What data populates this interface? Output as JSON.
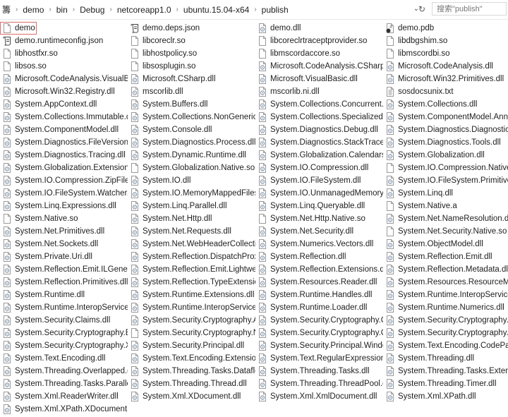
{
  "breadcrumb": [
    "籌",
    "demo",
    "bin",
    "Debug",
    "netcoreapp1.0",
    "ubuntu.15.04-x64",
    "publish"
  ],
  "search": {
    "placeholder": "搜索\"publish\""
  },
  "icons": {
    "dll": "gear-document-icon",
    "blank": "blank-file-icon",
    "json": "script-file-icon",
    "pdb": "pdb-file-icon",
    "txt": "text-file-icon"
  },
  "selected_index": 0,
  "items": [
    {
      "name": "demo",
      "icon": "blank"
    },
    {
      "name": "demo.deps.json",
      "icon": "json"
    },
    {
      "name": "demo.dll",
      "icon": "dll"
    },
    {
      "name": "demo.pdb",
      "icon": "pdb"
    },
    {
      "name": "demo.runtimeconfig.json",
      "icon": "json"
    },
    {
      "name": "libcoreclr.so",
      "icon": "blank"
    },
    {
      "name": "libcoreclrtraceptprovider.so",
      "icon": "blank"
    },
    {
      "name": "libdbgshim.so",
      "icon": "blank"
    },
    {
      "name": "libhostfxr.so",
      "icon": "blank"
    },
    {
      "name": "libhostpolicy.so",
      "icon": "blank"
    },
    {
      "name": "libmscordaccore.so",
      "icon": "blank"
    },
    {
      "name": "libmscordbi.so",
      "icon": "blank"
    },
    {
      "name": "libsos.so",
      "icon": "blank"
    },
    {
      "name": "libsosplugin.so",
      "icon": "blank"
    },
    {
      "name": "Microsoft.CodeAnalysis.CSharp.dll",
      "icon": "dll"
    },
    {
      "name": "Microsoft.CodeAnalysis.dll",
      "icon": "dll"
    },
    {
      "name": "Microsoft.CodeAnalysis.VisualBa...",
      "icon": "dll"
    },
    {
      "name": "Microsoft.CSharp.dll",
      "icon": "dll"
    },
    {
      "name": "Microsoft.VisualBasic.dll",
      "icon": "dll"
    },
    {
      "name": "Microsoft.Win32.Primitives.dll",
      "icon": "dll"
    },
    {
      "name": "Microsoft.Win32.Registry.dll",
      "icon": "dll"
    },
    {
      "name": "mscorlib.dll",
      "icon": "dll"
    },
    {
      "name": "mscorlib.ni.dll",
      "icon": "dll"
    },
    {
      "name": "sosdocsunix.txt",
      "icon": "txt"
    },
    {
      "name": "System.AppContext.dll",
      "icon": "dll"
    },
    {
      "name": "System.Buffers.dll",
      "icon": "dll"
    },
    {
      "name": "System.Collections.Concurrent.dll",
      "icon": "dll"
    },
    {
      "name": "System.Collections.dll",
      "icon": "dll"
    },
    {
      "name": "System.Collections.Immutable.dll",
      "icon": "dll"
    },
    {
      "name": "System.Collections.NonGeneric.dll",
      "icon": "dll"
    },
    {
      "name": "System.Collections.Specialized.dll",
      "icon": "dll"
    },
    {
      "name": "System.ComponentModel.Annot...",
      "icon": "dll"
    },
    {
      "name": "System.ComponentModel.dll",
      "icon": "dll"
    },
    {
      "name": "System.Console.dll",
      "icon": "dll"
    },
    {
      "name": "System.Diagnostics.Debug.dll",
      "icon": "dll"
    },
    {
      "name": "System.Diagnostics.DiagnosticSo...",
      "icon": "dll"
    },
    {
      "name": "System.Diagnostics.FileVersionInf...",
      "icon": "dll"
    },
    {
      "name": "System.Diagnostics.Process.dll",
      "icon": "dll"
    },
    {
      "name": "System.Diagnostics.StackTrace.dll",
      "icon": "dll"
    },
    {
      "name": "System.Diagnostics.Tools.dll",
      "icon": "dll"
    },
    {
      "name": "System.Diagnostics.Tracing.dll",
      "icon": "dll"
    },
    {
      "name": "System.Dynamic.Runtime.dll",
      "icon": "dll"
    },
    {
      "name": "System.Globalization.Calendars.dll",
      "icon": "dll"
    },
    {
      "name": "System.Globalization.dll",
      "icon": "dll"
    },
    {
      "name": "System.Globalization.Extensions.dll",
      "icon": "dll"
    },
    {
      "name": "System.Globalization.Native.so",
      "icon": "blank"
    },
    {
      "name": "System.IO.Compression.dll",
      "icon": "dll"
    },
    {
      "name": "System.IO.Compression.Native.so",
      "icon": "blank"
    },
    {
      "name": "System.IO.Compression.ZipFile.dll",
      "icon": "dll"
    },
    {
      "name": "System.IO.dll",
      "icon": "dll"
    },
    {
      "name": "System.IO.FileSystem.dll",
      "icon": "dll"
    },
    {
      "name": "System.IO.FileSystem.Primitives.dll",
      "icon": "dll"
    },
    {
      "name": "System.IO.FileSystem.Watcher.dll",
      "icon": "dll"
    },
    {
      "name": "System.IO.MemoryMappedFiles.dll",
      "icon": "dll"
    },
    {
      "name": "System.IO.UnmanagedMemorySt...",
      "icon": "dll"
    },
    {
      "name": "System.Linq.dll",
      "icon": "dll"
    },
    {
      "name": "System.Linq.Expressions.dll",
      "icon": "dll"
    },
    {
      "name": "System.Linq.Parallel.dll",
      "icon": "dll"
    },
    {
      "name": "System.Linq.Queryable.dll",
      "icon": "dll"
    },
    {
      "name": "System.Native.a",
      "icon": "blank"
    },
    {
      "name": "System.Native.so",
      "icon": "blank"
    },
    {
      "name": "System.Net.Http.dll",
      "icon": "dll"
    },
    {
      "name": "System.Net.Http.Native.so",
      "icon": "blank"
    },
    {
      "name": "System.Net.NameResolution.dll",
      "icon": "dll"
    },
    {
      "name": "System.Net.Primitives.dll",
      "icon": "dll"
    },
    {
      "name": "System.Net.Requests.dll",
      "icon": "dll"
    },
    {
      "name": "System.Net.Security.dll",
      "icon": "dll"
    },
    {
      "name": "System.Net.Security.Native.so",
      "icon": "blank"
    },
    {
      "name": "System.Net.Sockets.dll",
      "icon": "dll"
    },
    {
      "name": "System.Net.WebHeaderCollectio...",
      "icon": "dll"
    },
    {
      "name": "System.Numerics.Vectors.dll",
      "icon": "dll"
    },
    {
      "name": "System.ObjectModel.dll",
      "icon": "dll"
    },
    {
      "name": "System.Private.Uri.dll",
      "icon": "dll"
    },
    {
      "name": "System.Reflection.DispatchProxy....",
      "icon": "dll"
    },
    {
      "name": "System.Reflection.dll",
      "icon": "dll"
    },
    {
      "name": "System.Reflection.Emit.dll",
      "icon": "dll"
    },
    {
      "name": "System.Reflection.Emit.ILGenerati...",
      "icon": "dll"
    },
    {
      "name": "System.Reflection.Emit.Lightweig...",
      "icon": "dll"
    },
    {
      "name": "System.Reflection.Extensions.dll",
      "icon": "dll"
    },
    {
      "name": "System.Reflection.Metadata.dll",
      "icon": "dll"
    },
    {
      "name": "System.Reflection.Primitives.dll",
      "icon": "dll"
    },
    {
      "name": "System.Reflection.TypeExtensions...",
      "icon": "dll"
    },
    {
      "name": "System.Resources.Reader.dll",
      "icon": "dll"
    },
    {
      "name": "System.Resources.ResourceMan...",
      "icon": "dll"
    },
    {
      "name": "System.Runtime.dll",
      "icon": "dll"
    },
    {
      "name": "System.Runtime.Extensions.dll",
      "icon": "dll"
    },
    {
      "name": "System.Runtime.Handles.dll",
      "icon": "dll"
    },
    {
      "name": "System.Runtime.InteropServices.dll",
      "icon": "dll"
    },
    {
      "name": "System.Runtime.InteropServices....",
      "icon": "dll"
    },
    {
      "name": "System.Runtime.InteropServices....",
      "icon": "dll"
    },
    {
      "name": "System.Runtime.Loader.dll",
      "icon": "dll"
    },
    {
      "name": "System.Runtime.Numerics.dll",
      "icon": "dll"
    },
    {
      "name": "System.Security.Claims.dll",
      "icon": "dll"
    },
    {
      "name": "System.Security.Cryptography.Al...",
      "icon": "dll"
    },
    {
      "name": "System.Security.Cryptography.Cn...",
      "icon": "dll"
    },
    {
      "name": "System.Security.Cryptography.Cs...",
      "icon": "dll"
    },
    {
      "name": "System.Security.Cryptography.En...",
      "icon": "dll"
    },
    {
      "name": "System.Security.Cryptography.Na...",
      "icon": "blank"
    },
    {
      "name": "System.Security.Cryptography.Op...",
      "icon": "dll"
    },
    {
      "name": "System.Security.Cryptography.Pri...",
      "icon": "dll"
    },
    {
      "name": "System.Security.Cryptography.X5...",
      "icon": "dll"
    },
    {
      "name": "System.Security.Principal.dll",
      "icon": "dll"
    },
    {
      "name": "System.Security.Principal.Window...",
      "icon": "dll"
    },
    {
      "name": "System.Text.Encoding.CodePage...",
      "icon": "dll"
    },
    {
      "name": "System.Text.Encoding.dll",
      "icon": "dll"
    },
    {
      "name": "System.Text.Encoding.Extensions....",
      "icon": "dll"
    },
    {
      "name": "System.Text.RegularExpressions.dll",
      "icon": "dll"
    },
    {
      "name": "System.Threading.dll",
      "icon": "dll"
    },
    {
      "name": "System.Threading.Overlapped.dll",
      "icon": "dll"
    },
    {
      "name": "System.Threading.Tasks.Dataflow...",
      "icon": "dll"
    },
    {
      "name": "System.Threading.Tasks.dll",
      "icon": "dll"
    },
    {
      "name": "System.Threading.Tasks.Extensio...",
      "icon": "dll"
    },
    {
      "name": "System.Threading.Tasks.Parallel.dll",
      "icon": "dll"
    },
    {
      "name": "System.Threading.Thread.dll",
      "icon": "dll"
    },
    {
      "name": "System.Threading.ThreadPool.dll",
      "icon": "dll"
    },
    {
      "name": "System.Threading.Timer.dll",
      "icon": "dll"
    },
    {
      "name": "System.Xml.ReaderWriter.dll",
      "icon": "dll"
    },
    {
      "name": "System.Xml.XDocument.dll",
      "icon": "dll"
    },
    {
      "name": "System.Xml.XmlDocument.dll",
      "icon": "dll"
    },
    {
      "name": "System.Xml.XPath.dll",
      "icon": "dll"
    },
    {
      "name": "System.Xml.XPath.XDocument.dll",
      "icon": "dll"
    }
  ]
}
